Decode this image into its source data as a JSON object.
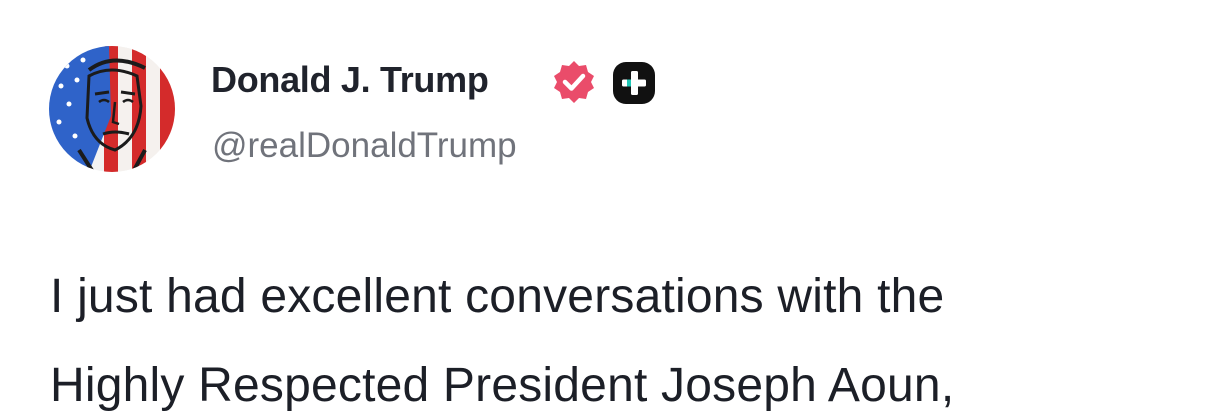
{
  "author": {
    "display_name": "Donald J. Trump",
    "handle": "@realDonaldTrump",
    "avatar_icon": "flag-portrait-avatar",
    "verified_icon": "verified-badge-icon",
    "plus_icon": "plus-badge-icon"
  },
  "post": {
    "lines": [
      "I just had excellent conversations with the",
      "Highly Respected President Joseph Aoun,"
    ]
  },
  "colors": {
    "verified": "#ea4c6a",
    "badge_bg": "#111111",
    "badge_accent": "#1fc8b6",
    "handle": "#70737b",
    "text": "#1c1f27"
  }
}
